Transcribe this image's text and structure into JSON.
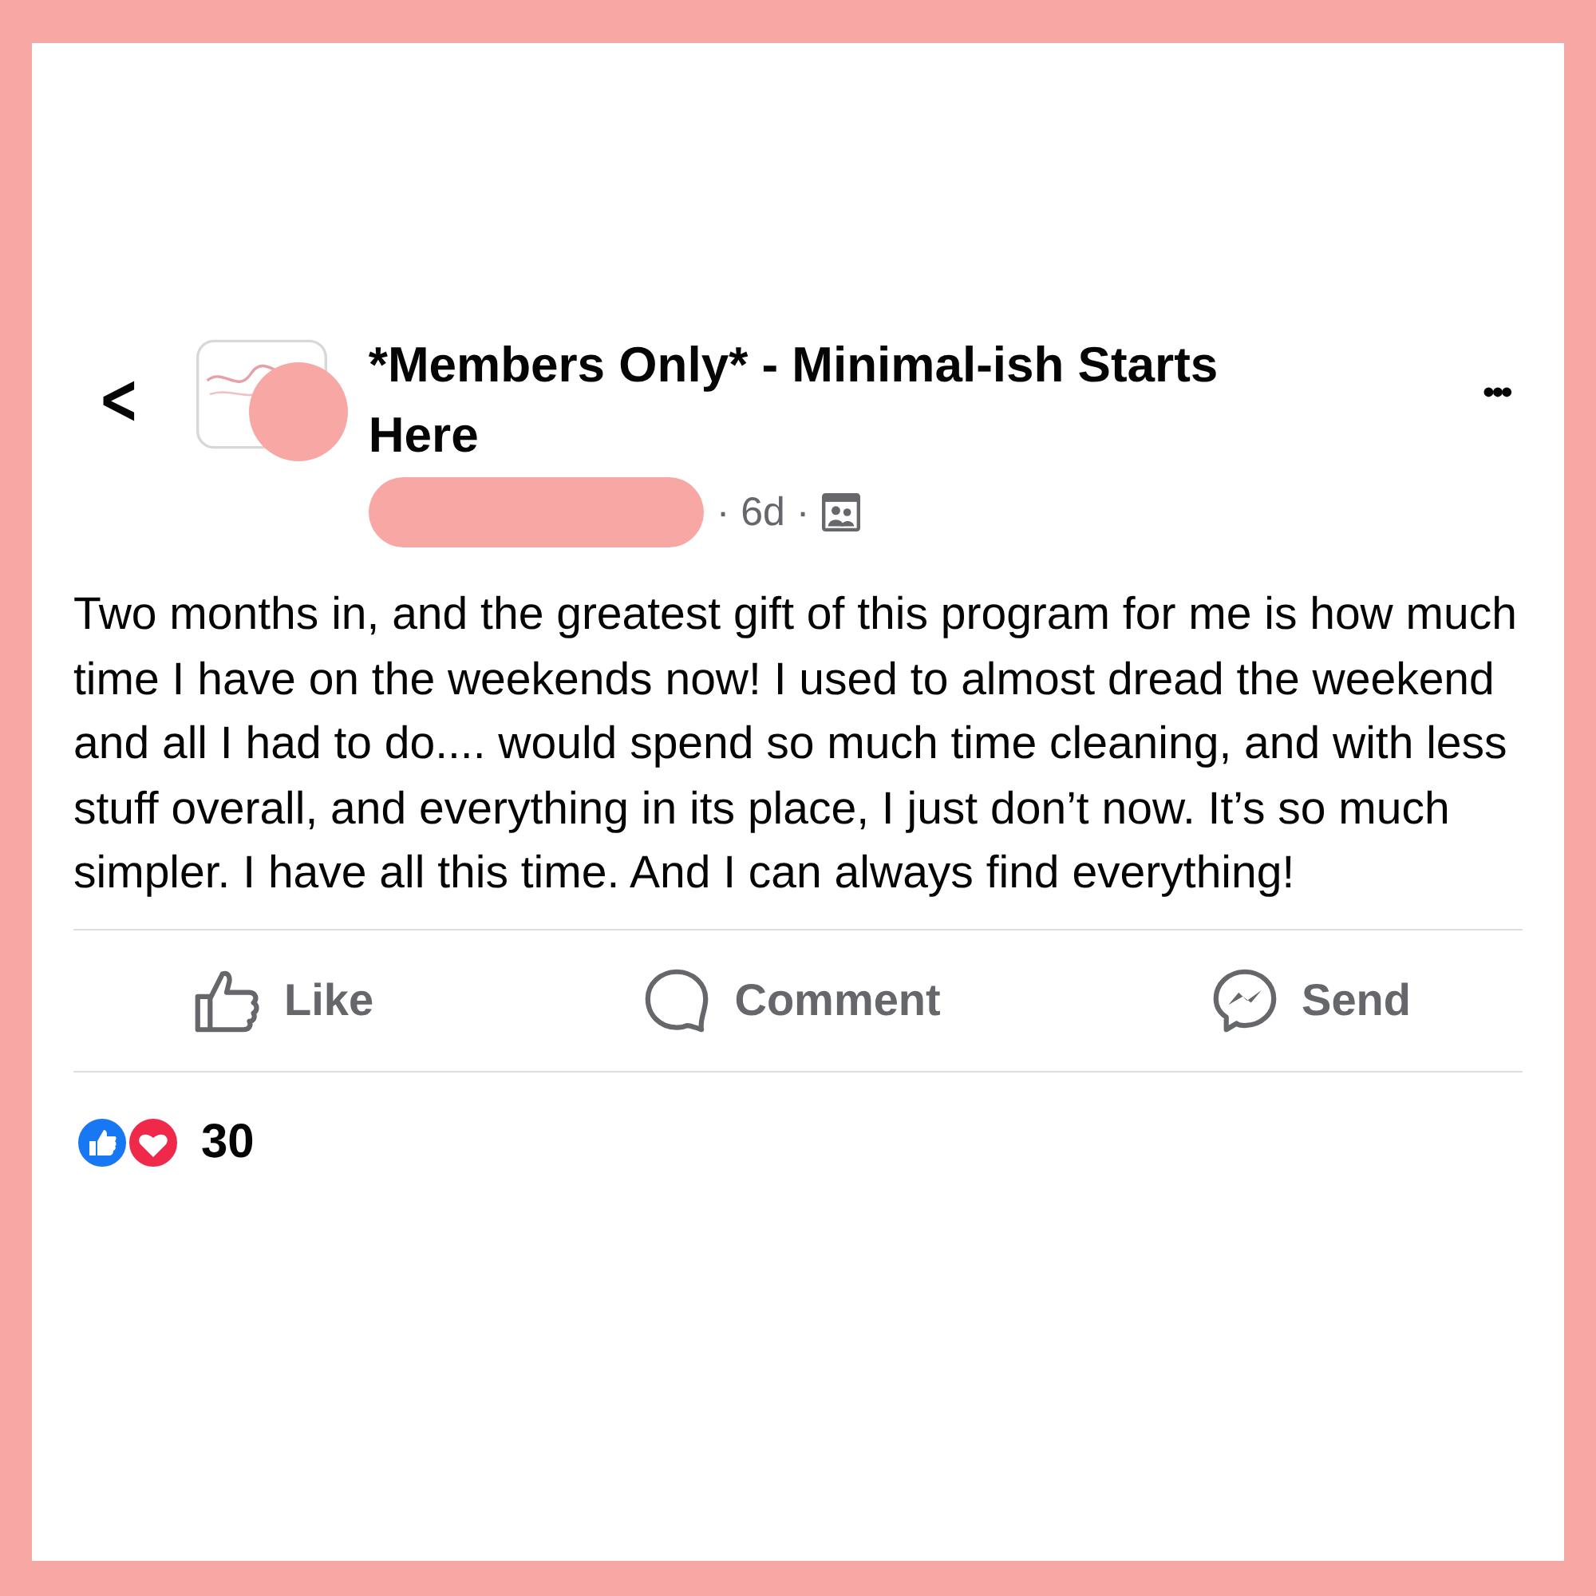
{
  "group": {
    "title": "*Members Only* - Minimal-ish Starts Here",
    "time": "6d",
    "separator": "·",
    "back": "<",
    "more": "•••"
  },
  "post": {
    "text": "Two months in, and the greatest gift of this program for me is how much time I have on the weekends now! I used to almost dread the weekend and all I had to do.... would spend so much time cleaning, and with less stuff overall, and everything in its place, I just don’t now. It’s so much simpler. I have all this time. And I can always find everything!"
  },
  "actions": [
    {
      "kind": "like",
      "label": "Like"
    },
    {
      "kind": "comment",
      "label": "Comment"
    },
    {
      "kind": "send",
      "label": "Send"
    }
  ],
  "reactions": {
    "count": "30"
  }
}
